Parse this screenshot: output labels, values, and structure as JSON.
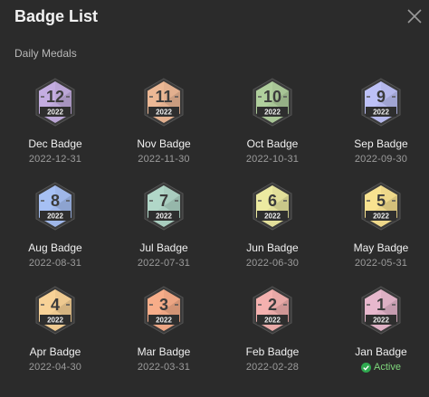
{
  "header": {
    "title": "Badge List",
    "close_icon": "close-icon"
  },
  "section": {
    "label": "Daily Medals"
  },
  "colors": {
    "active": "#2fa84f",
    "background": "#2b2b2b"
  },
  "badges": [
    {
      "number": "12",
      "year": "2022",
      "name": "Dec Badge",
      "date": "2022-12-31",
      "color": "#bba6d6"
    },
    {
      "number": "11",
      "year": "2022",
      "name": "Nov Badge",
      "date": "2022-11-30",
      "color": "#e2b08f"
    },
    {
      "number": "10",
      "year": "2022",
      "name": "Oct Badge",
      "date": "2022-10-31",
      "color": "#a8c596"
    },
    {
      "number": "9",
      "year": "2022",
      "name": "Sep Badge",
      "date": "2022-09-30",
      "color": "#b5b8eb"
    },
    {
      "number": "8",
      "year": "2022",
      "name": "Aug Badge",
      "date": "2022-08-31",
      "color": "#9fb7e9"
    },
    {
      "number": "7",
      "year": "2022",
      "name": "Jul Badge",
      "date": "2022-07-31",
      "color": "#a9cdbf"
    },
    {
      "number": "6",
      "year": "2022",
      "name": "Jun Badge",
      "date": "2022-06-30",
      "color": "#e2df9a"
    },
    {
      "number": "5",
      "year": "2022",
      "name": "May Badge",
      "date": "2022-05-31",
      "color": "#eed88a"
    },
    {
      "number": "4",
      "year": "2022",
      "name": "Apr Badge",
      "date": "2022-04-30",
      "color": "#eec990"
    },
    {
      "number": "3",
      "year": "2022",
      "name": "Mar Badge",
      "date": "2022-03-31",
      "color": "#eca583"
    },
    {
      "number": "2",
      "year": "2022",
      "name": "Feb Badge",
      "date": "2022-02-28",
      "color": "#e8a9a7"
    },
    {
      "number": "1",
      "year": "2022",
      "name": "Jan Badge",
      "status": "Active",
      "color": "#ddb0c4"
    }
  ]
}
